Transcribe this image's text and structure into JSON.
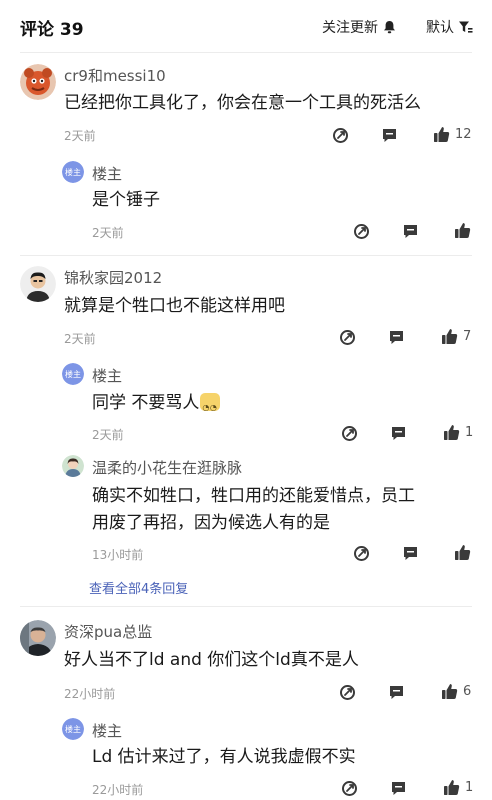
{
  "header": {
    "comments_title": "评论 39",
    "follow_label": "关注更新",
    "sort_label": "默认"
  },
  "comments": [
    {
      "author": "cr9和messi10",
      "text": "已经把你工具化了，你会在意一个工具的死活么",
      "time": "2天前",
      "like_count": "12",
      "reply": {
        "author": "楼主",
        "avatar_text": "楼主",
        "text": "是个锤子",
        "time": "2天前",
        "like_count": ""
      }
    },
    {
      "author": "锦秋家园2012",
      "text": "就算是个牲口也不能这样用吧",
      "time": "2天前",
      "like_count": "7",
      "replies": [
        {
          "author": "楼主",
          "avatar_text": "楼主",
          "text": "同学 不要骂人",
          "time": "2天前",
          "like_count": "1"
        },
        {
          "author": "温柔的小花生在逛脉脉",
          "text_line1": "确实不如牲口，牲口用的还能爱惜点，员工",
          "text_line2": "用废了再招，因为候选人有的是",
          "time": "13小时前",
          "like_count": ""
        }
      ],
      "view_all": "查看全部4条回复"
    },
    {
      "author": "资深pua总监",
      "text": "好人当不了ld and 你们这个ld真不是人",
      "time": "22小时前",
      "like_count": "6",
      "reply": {
        "author": "楼主",
        "avatar_text": "楼主",
        "text": "Ld 估计来过了，有人说我虚假不实",
        "time": "22小时前",
        "like_count": "1"
      }
    }
  ],
  "colors": {
    "accent_link": "#4b63b8",
    "lz_avatar": "#7d95e6",
    "icon": "#3a3a3a"
  },
  "icons": [
    "bell-icon",
    "filter-icon",
    "share-icon",
    "comment-icon",
    "thumbs-up-icon"
  ]
}
